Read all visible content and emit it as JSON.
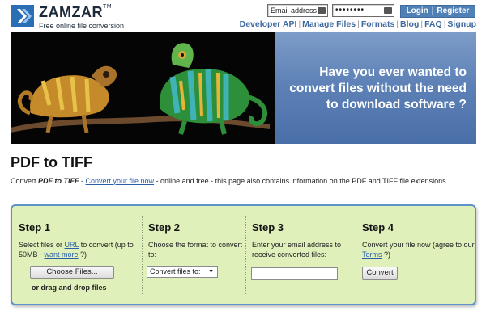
{
  "brand": {
    "name": "ZAMZAR",
    "tm": "TM",
    "tagline": "Free online file conversion",
    "accent": "#2a6fb5"
  },
  "login": {
    "email_placeholder": "Email address",
    "password_mask": "••••••••",
    "login_label": "Login",
    "separator": "|",
    "register_label": "Register"
  },
  "nav": {
    "items": [
      "Developer API",
      "Manage Files",
      "Formats",
      "Blog",
      "FAQ",
      "Signup"
    ],
    "separator": "|"
  },
  "banner": {
    "lines": [
      "Have you ever wanted to",
      "convert files without the need",
      "to download software ?"
    ]
  },
  "page": {
    "title": "PDF to TIFF",
    "intro_prefix": "Convert ",
    "intro_em": "PDF to TIFF",
    "intro_dash": " - ",
    "intro_link": "Convert your file now",
    "intro_suffix": " - online and free - this page also contains information on the PDF and TIFF file extensions."
  },
  "steps": {
    "s1": {
      "title": "Step 1",
      "text_a": "Select files or ",
      "link_url": "URL",
      "text_b": " to convert (up to 50MB - ",
      "link_more": "want more",
      "text_c": " ?)",
      "button": "Choose Files...",
      "drag": "or drag and drop files"
    },
    "s2": {
      "title": "Step 2",
      "text": "Choose the format to convert to:",
      "select_value": "Convert files to:",
      "caret": "▼"
    },
    "s3": {
      "title": "Step 3",
      "text": "Enter your email address to receive converted files:"
    },
    "s4": {
      "title": "Step 4",
      "text_a": "Convert your file now (agree to our ",
      "link_terms": "Terms",
      "text_b": " ?)",
      "button": "Convert"
    }
  }
}
